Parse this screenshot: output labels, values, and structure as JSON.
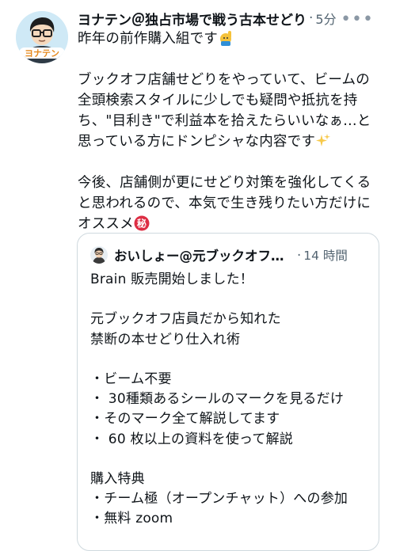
{
  "tweet": {
    "author_name": "ヨナテン＠独占市場で戦う古本せどり",
    "separator": "·",
    "time": "5分",
    "more_label": "•••",
    "avatar_label": "ヨナテン",
    "line_intro": "昨年の前作購入組です",
    "paragraph1": [
      "ブックオフ店舗せどりをやっていて、ビームの",
      "全頭検索スタイルに少しでも疑問や抵抗を持",
      "ち、\"目利き\"で利益本を拾えたらいいなぁ…と",
      "思っている方にドンピシャな内容です"
    ],
    "paragraph2": [
      "今後、店舗側が更にせどり対策を強化してくる",
      "と思われるので、本気で生き残りたい方だけに",
      "オススメ"
    ],
    "emoji": {
      "raise_hand": "🙋",
      "sparkles": "✨",
      "secret": "㊙"
    }
  },
  "quoted": {
    "author_name": "おいしょー@元ブックオフ店員",
    "separator": "·",
    "time": "14 時間",
    "lines": [
      "Brain 販売開始しました！",
      "",
      "元ブックオフ店員だから知れた",
      "禁断の本せどり仕入れ術",
      "",
      "・ビーム不要",
      "・ 30種類あるシールのマークを見るだけ",
      "・そのマーク全て解説してます",
      "・ 60 枚以上の資料を使って解説",
      "",
      "購入特典",
      "・チーム極（オープンチャット）への参加",
      "・無料 zoom"
    ]
  },
  "colors": {
    "text": "#0f1419",
    "muted": "#536471",
    "border": "#cfd9de",
    "avatar_bg": "#cfe9f6"
  }
}
